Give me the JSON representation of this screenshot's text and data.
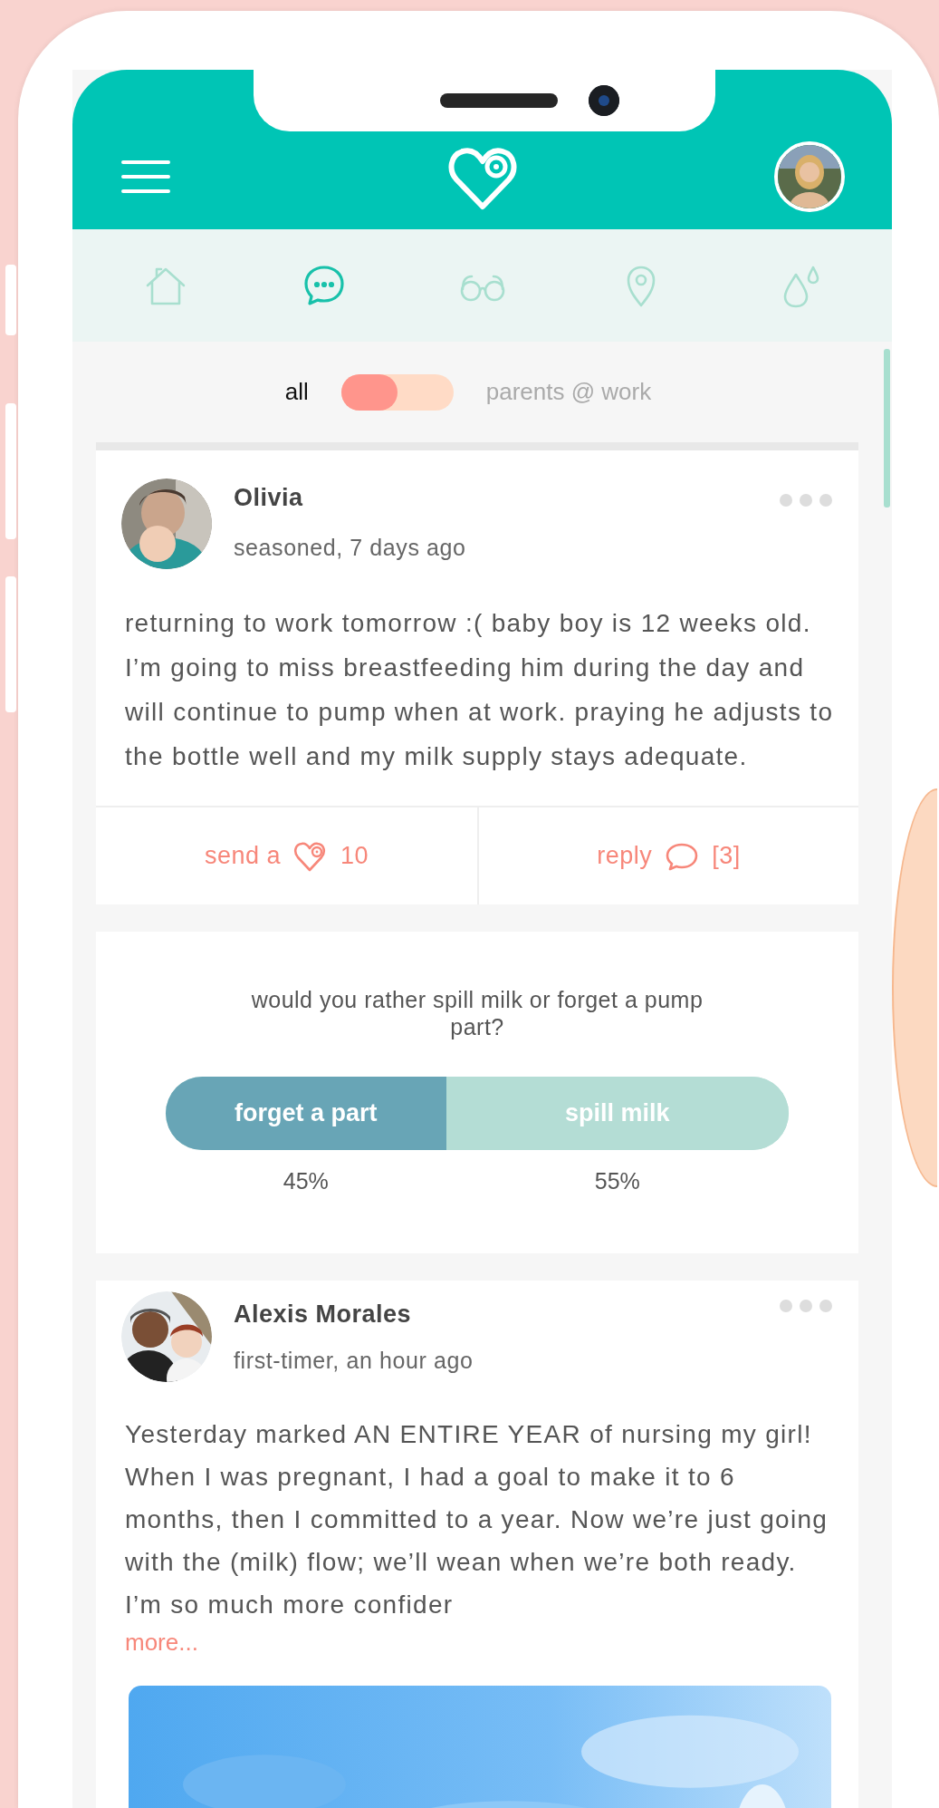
{
  "nav_tabs": [
    {
      "kind": "home",
      "selected": false
    },
    {
      "kind": "chat",
      "selected": true
    },
    {
      "kind": "glasses",
      "selected": false
    },
    {
      "kind": "location",
      "selected": false
    },
    {
      "kind": "drops",
      "selected": false
    }
  ],
  "feed_filter": {
    "options": [
      {
        "label": "all",
        "selected": true
      },
      {
        "label": "parents @ work",
        "selected": false
      }
    ]
  },
  "feed": [
    {
      "kind": "post",
      "author": "Olivia",
      "meta": "seasoned, 7 days ago",
      "body": "returning to work tomorrow :( baby boy is 12 weeks old. I’m going to miss breastfeeding him during the day and will continue to pump when at work. praying he adjusts to the bottle well and my milk supply stays adequate.",
      "actions": [
        {
          "kind": "send",
          "label": "send a",
          "count": "10"
        },
        {
          "kind": "reply",
          "label": "reply",
          "count": "[3]"
        }
      ]
    },
    {
      "kind": "poll",
      "question": "would you rather spill milk or forget a pump part?",
      "options": [
        {
          "label": "forget a part",
          "share": "45%",
          "level": 0.45
        },
        {
          "label": "spill milk",
          "share": "55%",
          "level": 0.55
        }
      ]
    },
    {
      "kind": "post",
      "author": "Alexis Morales",
      "meta": "first-timer, an hour ago",
      "body": "Yesterday marked AN ENTIRE YEAR of nursing my girl! When I was pregnant, I had a goal to make it to 6 months, then I committed to a year. Now we’re just going with the (milk) flow; we’ll wean when we’re both ready. I’m so much more confider",
      "more": "more..."
    }
  ]
}
